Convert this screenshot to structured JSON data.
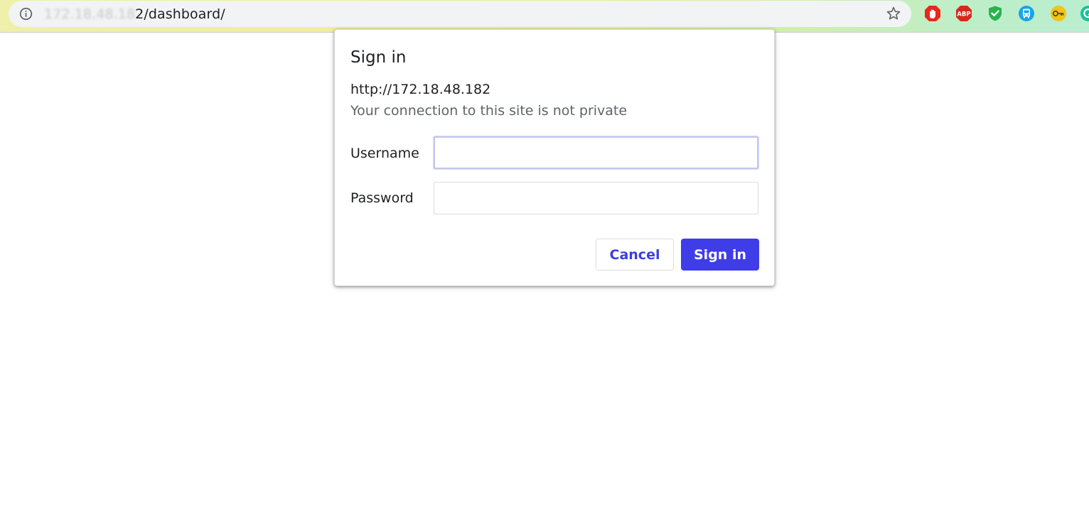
{
  "browser": {
    "url_blurred": "172.18.48.18",
    "url_suffix": "2/dashboard/",
    "extensions": [
      {
        "name": "adblock-stop-icon",
        "color": "#e8271d"
      },
      {
        "name": "adblock-plus-icon",
        "color": "#d8281c",
        "label": "ABP"
      },
      {
        "name": "shield-check-icon",
        "color": "#2bb24c"
      },
      {
        "name": "bus-icon",
        "color": "#1aa3e8"
      },
      {
        "name": "key-icon",
        "color": "#f2c318"
      },
      {
        "name": "grammarly-icon",
        "color": "#15c39a"
      }
    ]
  },
  "dialog": {
    "title": "Sign in",
    "origin": "http://172.18.48.182",
    "warning": "Your connection to this site is not private",
    "username_label": "Username",
    "username_value": "",
    "password_label": "Password",
    "password_value": "",
    "cancel_label": "Cancel",
    "signin_label": "Sign in",
    "accent_color": "#3f3de8"
  }
}
